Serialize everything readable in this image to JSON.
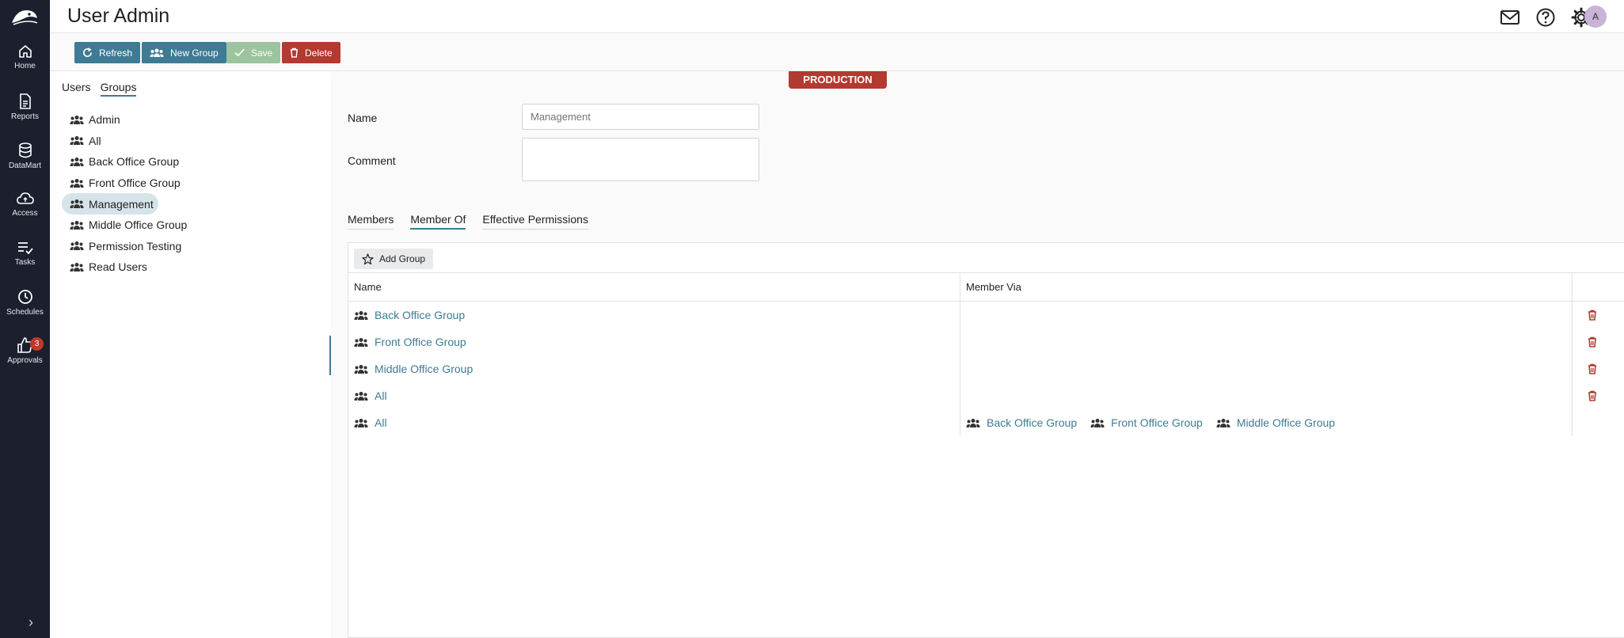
{
  "app": {
    "title": "User Admin",
    "avatar_initial": "A"
  },
  "nav": [
    {
      "label": "Home",
      "icon": "home-icon"
    },
    {
      "label": "Reports",
      "icon": "reports-icon"
    },
    {
      "label": "DataMart",
      "icon": "database-icon"
    },
    {
      "label": "Access",
      "icon": "cloud-icon"
    },
    {
      "label": "Tasks",
      "icon": "tasks-icon"
    },
    {
      "label": "Schedules",
      "icon": "clock-icon"
    },
    {
      "label": "Approvals",
      "icon": "thumbs-up-icon",
      "badge": "3"
    }
  ],
  "toolbar": {
    "refresh": "Refresh",
    "new_group": "New Group",
    "save": "Save",
    "delete": "Delete"
  },
  "left_tabs": {
    "users": "Users",
    "groups": "Groups"
  },
  "groups": [
    "Admin",
    "All",
    "Back Office Group",
    "Front Office Group",
    "Management",
    "Middle Office Group",
    "Permission Testing",
    "Read Users"
  ],
  "selected_group": "Management",
  "environment_badge": "PRODUCTION",
  "form": {
    "name_label": "Name",
    "name_placeholder": "Management",
    "comment_label": "Comment",
    "comment_value": ""
  },
  "detail_tabs": {
    "members": "Members",
    "member_of": "Member Of",
    "effective_permissions": "Effective Permissions"
  },
  "grid": {
    "add_group": "Add Group",
    "headers": {
      "name": "Name",
      "member_via": "Member Via"
    },
    "rows": [
      {
        "name": "Back Office Group",
        "via": [],
        "deletable": true
      },
      {
        "name": "Front Office Group",
        "via": [],
        "deletable": true
      },
      {
        "name": "Middle Office Group",
        "via": [],
        "deletable": true
      },
      {
        "name": "All",
        "via": [],
        "deletable": true
      },
      {
        "name": "All",
        "via": [
          "Back Office Group",
          "Front Office Group",
          "Middle Office Group"
        ],
        "deletable": false
      }
    ]
  },
  "colors": {
    "rail": "#1b1f2e",
    "accent": "#3f7b94",
    "danger": "#b33a30",
    "save": "#9cc49e"
  }
}
